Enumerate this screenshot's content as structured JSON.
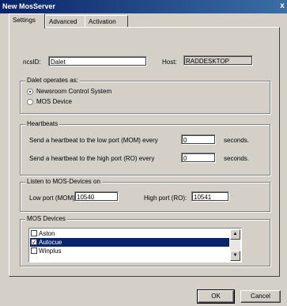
{
  "window": {
    "title": "New MosServer",
    "close_glyph": "x"
  },
  "tabs": [
    {
      "label": "Settings",
      "active": true
    },
    {
      "label": "Advanced",
      "active": false
    },
    {
      "label": "Activation",
      "active": false
    }
  ],
  "settings": {
    "ncsid_label": "ncsID:",
    "ncsid_value": "Dalet",
    "host_label": "Host:",
    "host_value": "RADDESKTOP"
  },
  "operates_as": {
    "title": "Dalet operates as:",
    "options": [
      {
        "label": "Newsroom Control System",
        "selected": true
      },
      {
        "label": "MOS Device",
        "selected": false
      }
    ]
  },
  "heartbeats": {
    "title": "Heartbeats",
    "low_label": "Send a heartbeat to  the low port (MOM) every",
    "low_value": "0",
    "high_label": "Send a heartbeat to the high port (RO) every",
    "high_value": "0",
    "unit": "seconds."
  },
  "listen": {
    "title": "Listen to MOS-Devices on",
    "low_label": "Low port (MOM):",
    "low_value": "10540",
    "high_label": "High port (RO):",
    "high_value": "10541"
  },
  "mos_devices": {
    "title": "MOS Devices",
    "items": [
      {
        "label": "Aston",
        "checked": false,
        "selected": false
      },
      {
        "label": "Autocue",
        "checked": true,
        "selected": true
      },
      {
        "label": "Winplus",
        "checked": false,
        "selected": false
      }
    ],
    "check_glyph": "✓",
    "scroll_up_icon": "▲",
    "scroll_down_icon": "▼"
  },
  "buttons": {
    "ok": "OK",
    "cancel": "Cancel"
  },
  "colors": {
    "titlebar": "#0a246a",
    "selection": "#0a246a",
    "face": "#d4d0c8"
  }
}
